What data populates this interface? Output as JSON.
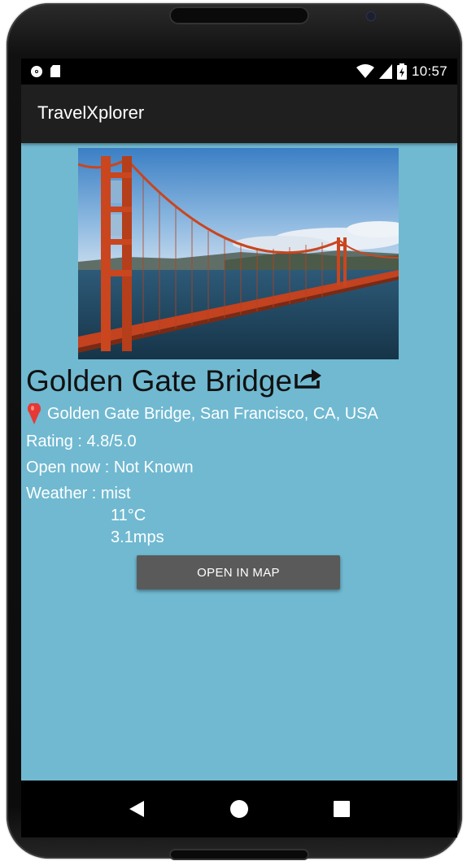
{
  "status_bar": {
    "time": "10:57",
    "icons": [
      "record-dot-icon",
      "sd-card-icon",
      "wifi-icon",
      "cell-signal-icon",
      "battery-charging-icon"
    ]
  },
  "app_bar": {
    "title": "TravelXplorer"
  },
  "place": {
    "image": "golden-gate-bridge-photo",
    "name": "Golden Gate Bridge",
    "address": "Golden Gate Bridge, San Francisco, CA, USA",
    "rating": "Rating : 4.8/5.0",
    "open_now": "Open now : Not Known",
    "weather_condition": "Weather : mist",
    "temperature": "11°C",
    "wind_speed": "3.1mps"
  },
  "actions": {
    "open_map_label": "OPEN IN MAP"
  },
  "nav_bar": {
    "icons": [
      "back-icon",
      "home-icon",
      "recents-icon"
    ]
  },
  "colors": {
    "screen_background": "#70b9d1",
    "app_bar": "#1f1f1f",
    "button": "#5a5a5a",
    "pin": "#e53935"
  }
}
